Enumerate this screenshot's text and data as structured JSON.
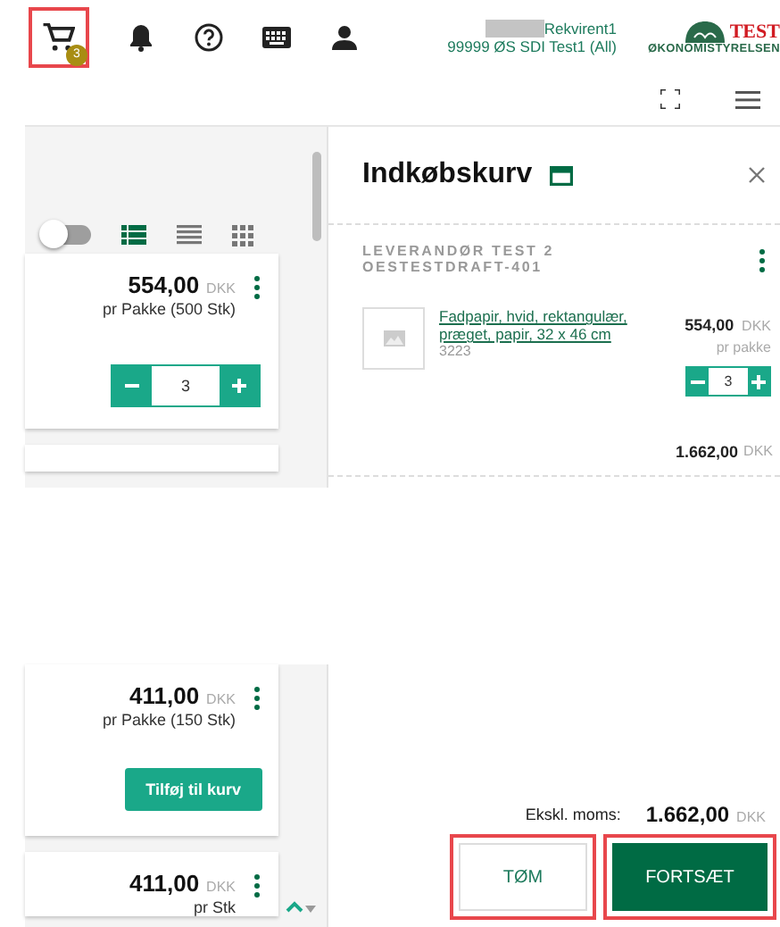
{
  "header": {
    "cart": {
      "badge": "3",
      "highlighted": true
    },
    "user": {
      "name": "Rekvirent1",
      "account": "99999 ØS SDI Test1 (All)"
    },
    "logo": {
      "test": "TEST",
      "name": "ØKONOMISTYRELSEN"
    }
  },
  "view_toggle": {
    "on": false
  },
  "view_modes": [
    {
      "kind": "list",
      "selected": true
    },
    {
      "kind": "lines",
      "selected": false
    },
    {
      "kind": "grid",
      "selected": false
    }
  ],
  "products_top": [
    {
      "price": "554,00",
      "currency": "DKK",
      "unit": "pr Pakke (500 Stk)",
      "kind": "stepper",
      "quantity": "3"
    }
  ],
  "cart": {
    "title": "Indkøbskurv",
    "supplier": [
      "LEVERANDØR TEST 2",
      "OESTESTDRAFT-401"
    ],
    "items": [
      {
        "name": "Fadpapir, hvid, rektangulær, præget, papir, 32 x 46 cm",
        "number": "3223",
        "price": "554,00",
        "currency": "DKK",
        "unit": "pr pakke",
        "quantity": "3",
        "total": "1.662,00",
        "total_currency": "DKK"
      }
    ]
  },
  "products_bottom": [
    {
      "price": "411,00",
      "currency": "DKK",
      "unit": "pr Pakke (150 Stk)",
      "kind": "add",
      "button": "Tilføj til kurv"
    },
    {
      "price": "411,00",
      "currency": "DKK",
      "unit": "pr Stk",
      "kind": "plain"
    }
  ],
  "summary": {
    "label": "Ekskl. moms:",
    "amount": "1.662,00",
    "currency": "DKK"
  },
  "buttons": [
    {
      "label": "TØM",
      "kind": "secondary",
      "highlighted": true
    },
    {
      "label": "FORTSÆT",
      "kind": "primary",
      "highlighted": true
    }
  ]
}
